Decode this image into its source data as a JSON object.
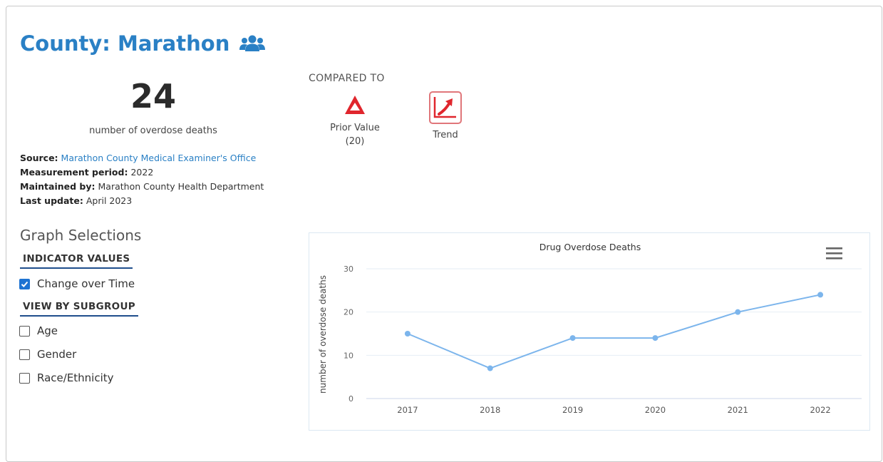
{
  "header": {
    "title": "County: Marathon",
    "icon": "users-icon"
  },
  "indicator": {
    "value": "24",
    "label": "number of overdose deaths"
  },
  "meta": {
    "source_label": "Source:",
    "source_value": "Marathon County Medical Examiner's Office",
    "period_label": "Measurement period:",
    "period_value": "2022",
    "maintained_label": "Maintained by:",
    "maintained_value": "Marathon County Health Department",
    "update_label": "Last update:",
    "update_value": "April 2023"
  },
  "comparison": {
    "heading": "COMPARED TO",
    "prior_label": "Prior Value",
    "prior_value": "(20)",
    "trend_label": "Trend",
    "colors": {
      "delta": "#e0262d",
      "trend": "#e0262d"
    }
  },
  "graph_selections": {
    "heading": "Graph Selections",
    "indicator_values_heading": "INDICATOR VALUES",
    "change_over_time_label": "Change over Time",
    "change_over_time_checked": true,
    "subgroup_heading": "VIEW BY SUBGROUP",
    "subgroups": [
      {
        "label": "Age",
        "checked": false
      },
      {
        "label": "Gender",
        "checked": false
      },
      {
        "label": "Race/Ethnicity",
        "checked": false
      }
    ]
  },
  "chart_data": {
    "type": "line",
    "title": "Drug Overdose Deaths",
    "xlabel": "",
    "ylabel": "number of overdose deaths",
    "categories": [
      "2017",
      "2018",
      "2019",
      "2020",
      "2021",
      "2022"
    ],
    "series": [
      {
        "values": [
          15,
          7,
          14,
          14,
          20,
          24
        ],
        "color": "#7cb5ec"
      }
    ],
    "ylim": [
      0,
      30
    ],
    "yticks": [
      0,
      10,
      20,
      30
    ],
    "grid": true,
    "menu_icon": "hamburger-menu-icon"
  }
}
